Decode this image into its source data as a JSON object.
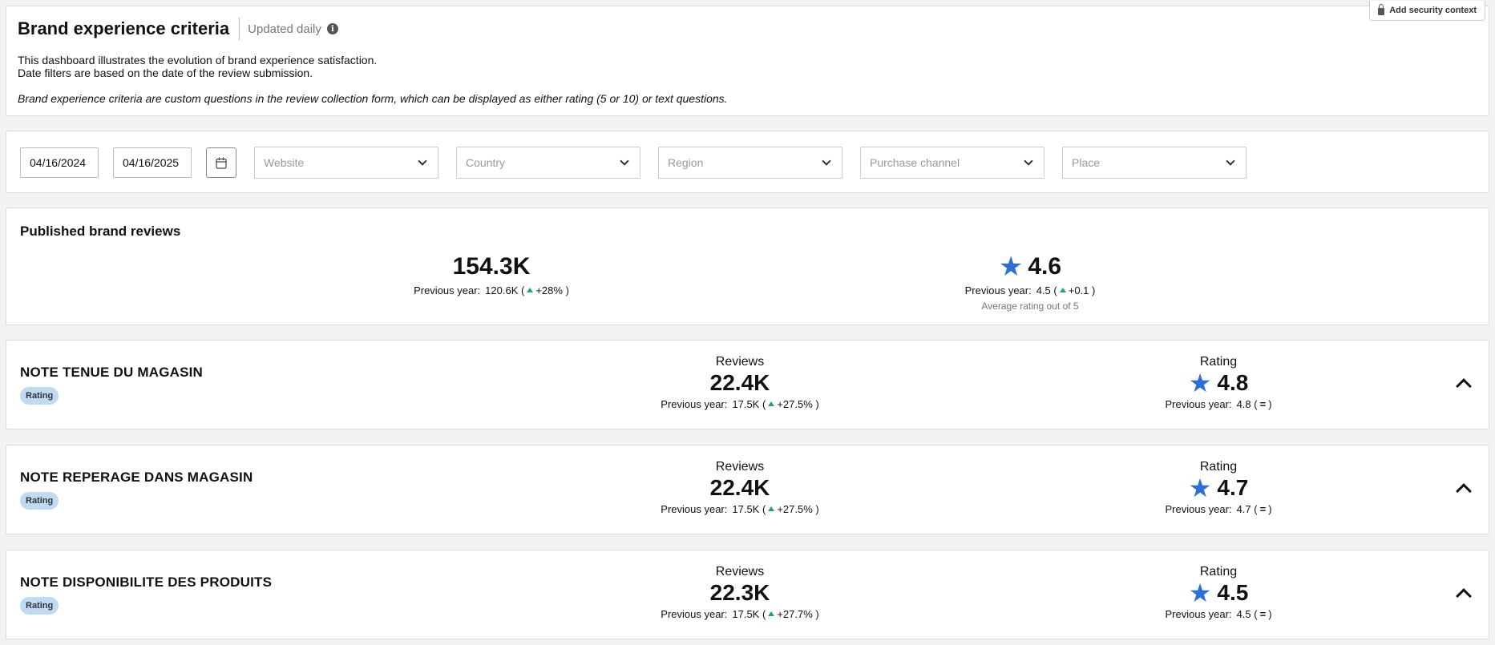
{
  "header": {
    "title": "Brand experience criteria",
    "updated": "Updated daily",
    "desc_line1": "This dashboard illustrates the evolution of brand experience satisfaction.",
    "desc_line2": "Date filters are based on the date of the review submission.",
    "desc_italic": "Brand experience criteria are custom questions in the review collection form, which can be displayed as either rating (5 or 10) or text questions.",
    "security_button": "Add security context"
  },
  "filters": {
    "start_date": "04/16/2024",
    "end_date": "04/16/2025",
    "website": "Website",
    "country": "Country",
    "region": "Region",
    "purchase_channel": "Purchase channel",
    "place": "Place"
  },
  "published": {
    "title": "Published brand reviews",
    "reviews": {
      "value": "154.3K",
      "prev_label": "Previous year:",
      "prev_value": "120.6K",
      "delta": "+28%"
    },
    "rating": {
      "value": "4.6",
      "prev_label": "Previous year:",
      "prev_value": "4.5",
      "delta": "+0.1",
      "note": "Average rating out of 5"
    }
  },
  "criteria": [
    {
      "title": "NOTE TENUE DU MAGASIN",
      "badge": "Rating",
      "reviews_label": "Reviews",
      "reviews_value": "22.4K",
      "reviews_prev_label": "Previous year:",
      "reviews_prev": "17.5K",
      "reviews_delta": "+27.5%",
      "rating_label": "Rating",
      "rating_value": "4.8",
      "rating_prev_label": "Previous year:",
      "rating_prev": "4.8"
    },
    {
      "title": "NOTE REPERAGE DANS MAGASIN",
      "badge": "Rating",
      "reviews_label": "Reviews",
      "reviews_value": "22.4K",
      "reviews_prev_label": "Previous year:",
      "reviews_prev": "17.5K",
      "reviews_delta": "+27.5%",
      "rating_label": "Rating",
      "rating_value": "4.7",
      "rating_prev_label": "Previous year:",
      "rating_prev": "4.7"
    },
    {
      "title": "NOTE DISPONIBILITE DES PRODUITS",
      "badge": "Rating",
      "reviews_label": "Reviews",
      "reviews_value": "22.3K",
      "reviews_prev_label": "Previous year:",
      "reviews_prev": "17.5K",
      "reviews_delta": "+27.7%",
      "rating_label": "Rating",
      "rating_value": "4.5",
      "rating_prev_label": "Previous year:",
      "rating_prev": "4.5"
    }
  ],
  "colors": {
    "accent_star": "#2b6fd6",
    "positive": "#1fa37a",
    "badge_bg": "#bfdaf3"
  }
}
